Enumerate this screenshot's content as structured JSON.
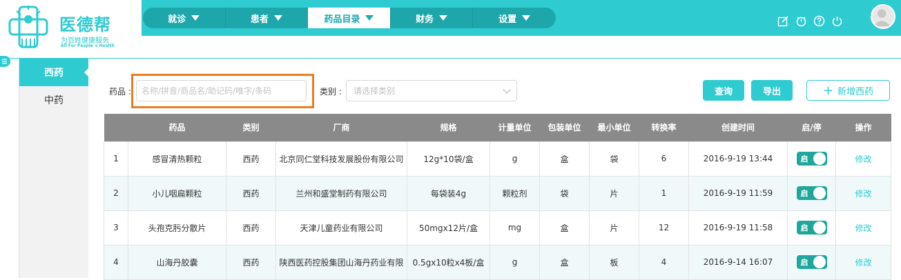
{
  "logo": {
    "title": "医德帮",
    "subtitle": "为百姓健康服务",
    "tagline": "All For People`s Health"
  },
  "nav": {
    "items": [
      {
        "label": "就诊"
      },
      {
        "label": "患者"
      },
      {
        "label": "药品目录",
        "active": true
      },
      {
        "label": "财务"
      },
      {
        "label": "设置"
      }
    ]
  },
  "toolbar_icons": [
    "edit-icon",
    "timer-icon",
    "help-icon",
    "power-icon"
  ],
  "sidebar": {
    "tabs": [
      {
        "label": "西药",
        "active": true
      },
      {
        "label": "中药"
      }
    ]
  },
  "filters": {
    "drug_label": "药品 :",
    "search_placeholder": "名称/拼音/商品名/助记码/唯字/条码",
    "category_label": "类别 :",
    "category_placeholder": "请选择类别"
  },
  "actions": {
    "query": "查询",
    "export": "导出",
    "add": "新增西药"
  },
  "table": {
    "headers": [
      "",
      "药品",
      "类别",
      "厂商",
      "规格",
      "计量单位",
      "包装单位",
      "最小单位",
      "转换率",
      "创建时间",
      "启/停",
      "操作"
    ],
    "rows": [
      {
        "no": "1",
        "drug": "感冒清热颗粒",
        "category": "西药",
        "maker": "北京同仁堂科技发展股份有限公司",
        "spec": "12g*10袋/盒",
        "unit": "g",
        "pack": "盒",
        "min": "袋",
        "rate": "6",
        "created": "2016-9-19 13:44",
        "status": "启",
        "op": "修改"
      },
      {
        "no": "2",
        "drug": "小儿咽扁颗粒",
        "category": "西药",
        "maker": "兰州和盛堂制药有限公司",
        "spec": "每袋装4g",
        "unit": "颗粒剂",
        "pack": "袋",
        "min": "片",
        "rate": "1",
        "created": "2016-9-19 11:59",
        "status": "启",
        "op": "修改"
      },
      {
        "no": "3",
        "drug": "头孢克肟分散片",
        "category": "西药",
        "maker": "天津儿童药业有限公司",
        "spec": "50mgx12片/盒",
        "unit": "mg",
        "pack": "盒",
        "min": "片",
        "rate": "12",
        "created": "2016-9-19 11:58",
        "status": "启",
        "op": "修改"
      },
      {
        "no": "4",
        "drug": "山海丹胶囊",
        "category": "西药",
        "maker": "陕西医药控股集团山海丹药业有限",
        "spec": "0.5gx10粒x4板/盒",
        "unit": "g",
        "pack": "盒",
        "min": "板",
        "rate": "4",
        "created": "2016-9-14 16:07",
        "status": "启",
        "op": "修改"
      }
    ]
  },
  "colors": {
    "brand": "#2ecbd0",
    "nav_bg": "#1da7ab",
    "table_header": "#8a8a8a",
    "highlight": "#f07a20",
    "toggle_on": "#1ea79a"
  }
}
